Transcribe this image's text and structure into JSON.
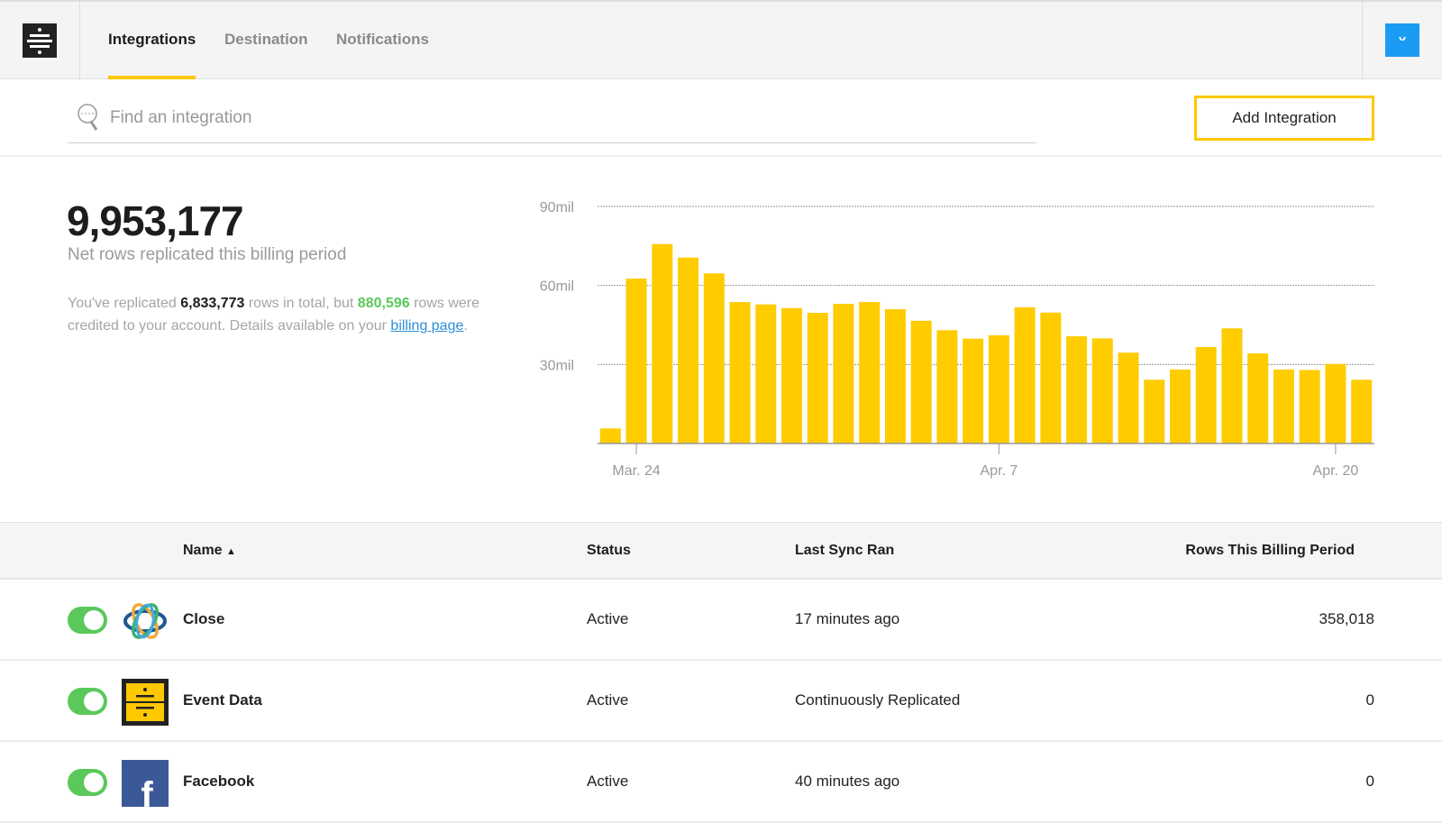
{
  "nav": {
    "tabs": [
      {
        "label": "Integrations",
        "active": true
      },
      {
        "label": "Destination",
        "active": false
      },
      {
        "label": "Notifications",
        "active": false
      }
    ],
    "avatar_icon": "smiley-icon",
    "accent": "#ffc800",
    "avatar_color": "#1a9cf5"
  },
  "search": {
    "placeholder": "Find an integration",
    "value": ""
  },
  "toolbar": {
    "add_label": "Add Integration"
  },
  "stats": {
    "total": "9,953,177",
    "total_label": "Net rows replicated this billing period",
    "detail_pre": "You've replicated ",
    "replicated": "6,833,773",
    "detail_mid": " rows in total, but ",
    "credited": "880,596",
    "detail_post": " rows were credited to your account. Details available on your ",
    "billing_link": "billing page",
    "detail_end": "."
  },
  "chart_data": {
    "type": "bar",
    "color": "#ffcc00",
    "grid": true,
    "ylim": [
      0,
      90
    ],
    "y_ticks": [
      {
        "value": 30,
        "label": "30mil"
      },
      {
        "value": 60,
        "label": "60mil"
      },
      {
        "value": 90,
        "label": "90mil"
      }
    ],
    "x_ticks": [
      {
        "index": 1,
        "label": "Mar. 24"
      },
      {
        "index": 15,
        "label": "Apr. 7"
      },
      {
        "index": 28,
        "label": "Apr. 20"
      }
    ],
    "values": [
      5.7,
      62.6,
      75.7,
      70.6,
      64.6,
      53.7,
      52.8,
      51.4,
      49.6,
      53,
      53.7,
      51,
      46.6,
      43,
      39.8,
      41.1,
      51.7,
      49.7,
      40.7,
      39.9,
      34.5,
      24.2,
      28.1,
      36.6,
      43.7,
      34.2,
      28.1,
      27.9,
      30.2,
      24.2
    ]
  },
  "table": {
    "columns": {
      "name": "Name",
      "status": "Status",
      "sync": "Last Sync Ran",
      "rows": "Rows This Billing Period"
    },
    "sort_icon": "sort-ascending-icon",
    "rows": [
      {
        "name": "Close",
        "status": "Active",
        "sync": "17 minutes ago",
        "rows": "358,018",
        "enabled": true,
        "logo": "close-logo"
      },
      {
        "name": "Event Data",
        "status": "Active",
        "sync": "Continuously Replicated",
        "rows": "0",
        "enabled": true,
        "logo": "event-data-logo"
      },
      {
        "name": "Facebook",
        "status": "Active",
        "sync": "40 minutes ago",
        "rows": "0",
        "enabled": true,
        "logo": "facebook-logo"
      }
    ]
  }
}
